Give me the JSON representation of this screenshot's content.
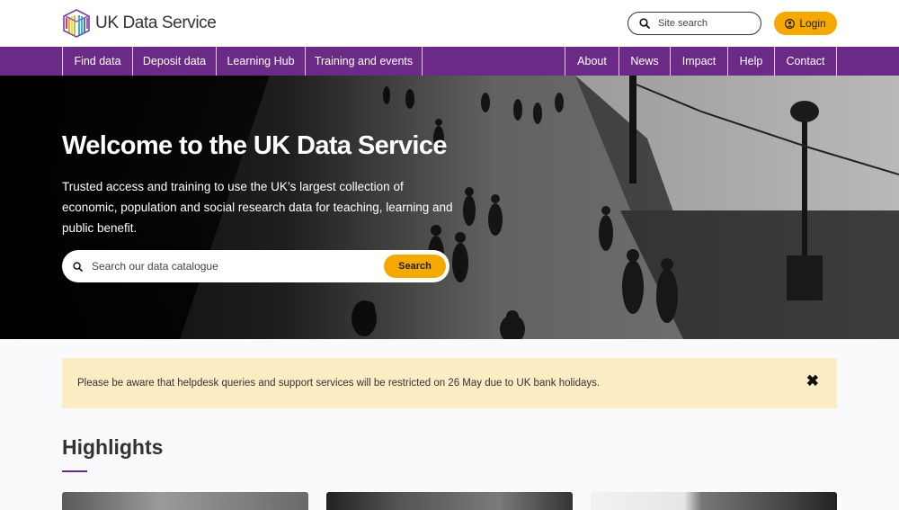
{
  "header": {
    "logo_text": "UK Data Service",
    "site_search_placeholder": "Site search",
    "login_label": "Login"
  },
  "nav": {
    "left": [
      "Find data",
      "Deposit data",
      "Learning Hub",
      "Training and events"
    ],
    "right": [
      "About",
      "News",
      "Impact",
      "Help",
      "Contact"
    ]
  },
  "hero": {
    "title": "Welcome to the UK Data Service",
    "description": "Trusted access and training to use the UK’s largest collection of economic, population and social research data for teaching, learning and public benefit.",
    "search_placeholder": "Search our data catalogue",
    "search_button": "Search"
  },
  "alert": {
    "message": "Please be aware that helpdesk queries and support services will be restricted on 26 May due to UK bank holidays.",
    "close_icon": "close-icon"
  },
  "highlights": {
    "title": "Highlights"
  },
  "colors": {
    "brand_purple": "#6b2a85",
    "accent_yellow": "#f5a800",
    "alert_bg": "#fbecc4"
  }
}
